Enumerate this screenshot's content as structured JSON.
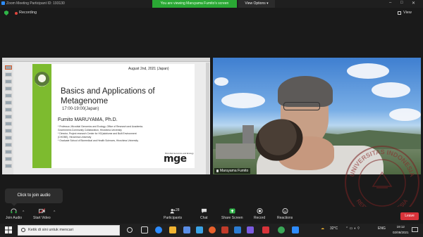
{
  "window": {
    "title": "Zoom Meeting Participant ID: 193130",
    "viewing_banner": "You are viewing Maruyama Fumito's screen",
    "view_options": "View Options ▾",
    "controls": {
      "minimize": "–",
      "maximize": "□",
      "close": "✕"
    }
  },
  "topbar": {
    "recording": "Recording",
    "view": "View"
  },
  "slide": {
    "date": "August 2nd, 2021 (Japan)",
    "title_line1": "Basics and Applications of",
    "title_line2": "Metagenome",
    "time": "17:00-19:00(Japan)",
    "presenter": "Fumito MARUYAMA, Ph.D.",
    "affiliations": [
      "* Professor, Microbial Genomics and Ecology, Office of Research and Academia-",
      "  Government-Community Collaboration, Hiroshima University",
      "* Director, Project research Center for HO(alobiome and Built Environment",
      "  (CHOBE), Hiroshima University",
      "* Graduate School of Biomedical and Health Sciences, Hiroshima University"
    ],
    "logo_label": "Microbial Genomics and Ecology",
    "logo_text": "mge"
  },
  "video": {
    "participant_name": "Maruyama Fumito"
  },
  "tooltip": "Click to join audio",
  "toolbar": {
    "join_audio": "Join Audio",
    "start_video": "Start Video",
    "participants": "Participants",
    "participants_count": "28",
    "chat": "Chat",
    "share_screen": "Share Screen",
    "record": "Record",
    "reactions": "Reactions",
    "leave": "Leave"
  },
  "taskbar": {
    "search_placeholder": "Ketik di sini untuk mencari",
    "temperature": "32°C",
    "language": "ENG",
    "time": "19:12",
    "date": "02/08/2021"
  },
  "watermark": {
    "text_top": "UNIVERSITAS INDONESIA",
    "text_bottom": "REPUBLIK INDONESIA"
  },
  "colors": {
    "banner_green": "#2aa834",
    "share_green": "#2fb548",
    "leave_red": "#d8333a",
    "slide_green": "#7dbb2f",
    "zoom_blue": "#2d8cff"
  }
}
